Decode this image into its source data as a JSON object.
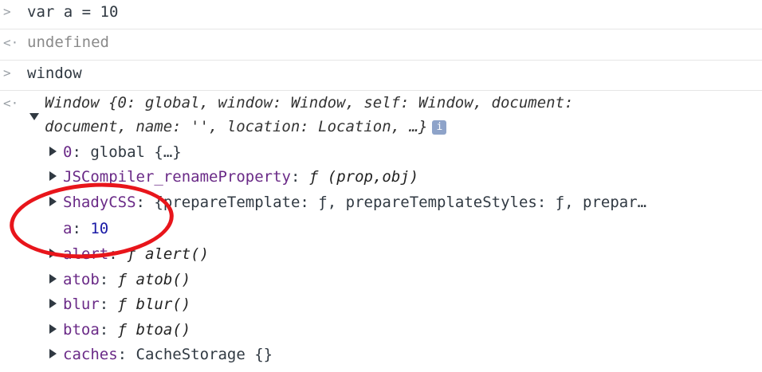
{
  "console": {
    "prompt_glyph": ">",
    "result_glyph": "<·",
    "input1": "var a = 10",
    "output1": "undefined",
    "input2": "window",
    "window_summary_line1": "Window {0: global, window: Window, self: Window, document:",
    "window_summary_line2": "document, name: '', location: Location, …}",
    "info_icon_label": "i",
    "properties": [
      {
        "key": "0",
        "value": "global {…}"
      },
      {
        "key": "JSCompiler_renameProperty",
        "value": "ƒ (prop,obj)"
      },
      {
        "key": "ShadyCSS",
        "value": "{prepareTemplate: ƒ, prepareTemplateStyles: ƒ, prepar…"
      },
      {
        "key": "a",
        "value": "10"
      },
      {
        "key": "alert",
        "value": "ƒ alert()"
      },
      {
        "key": "atob",
        "value": "ƒ atob()"
      },
      {
        "key": "blur",
        "value": "ƒ blur()"
      },
      {
        "key": "btoa",
        "value": "ƒ btoa()"
      },
      {
        "key": "caches",
        "value": "CacheStorage {}"
      }
    ]
  },
  "colors": {
    "highlight": "#e8151b"
  }
}
